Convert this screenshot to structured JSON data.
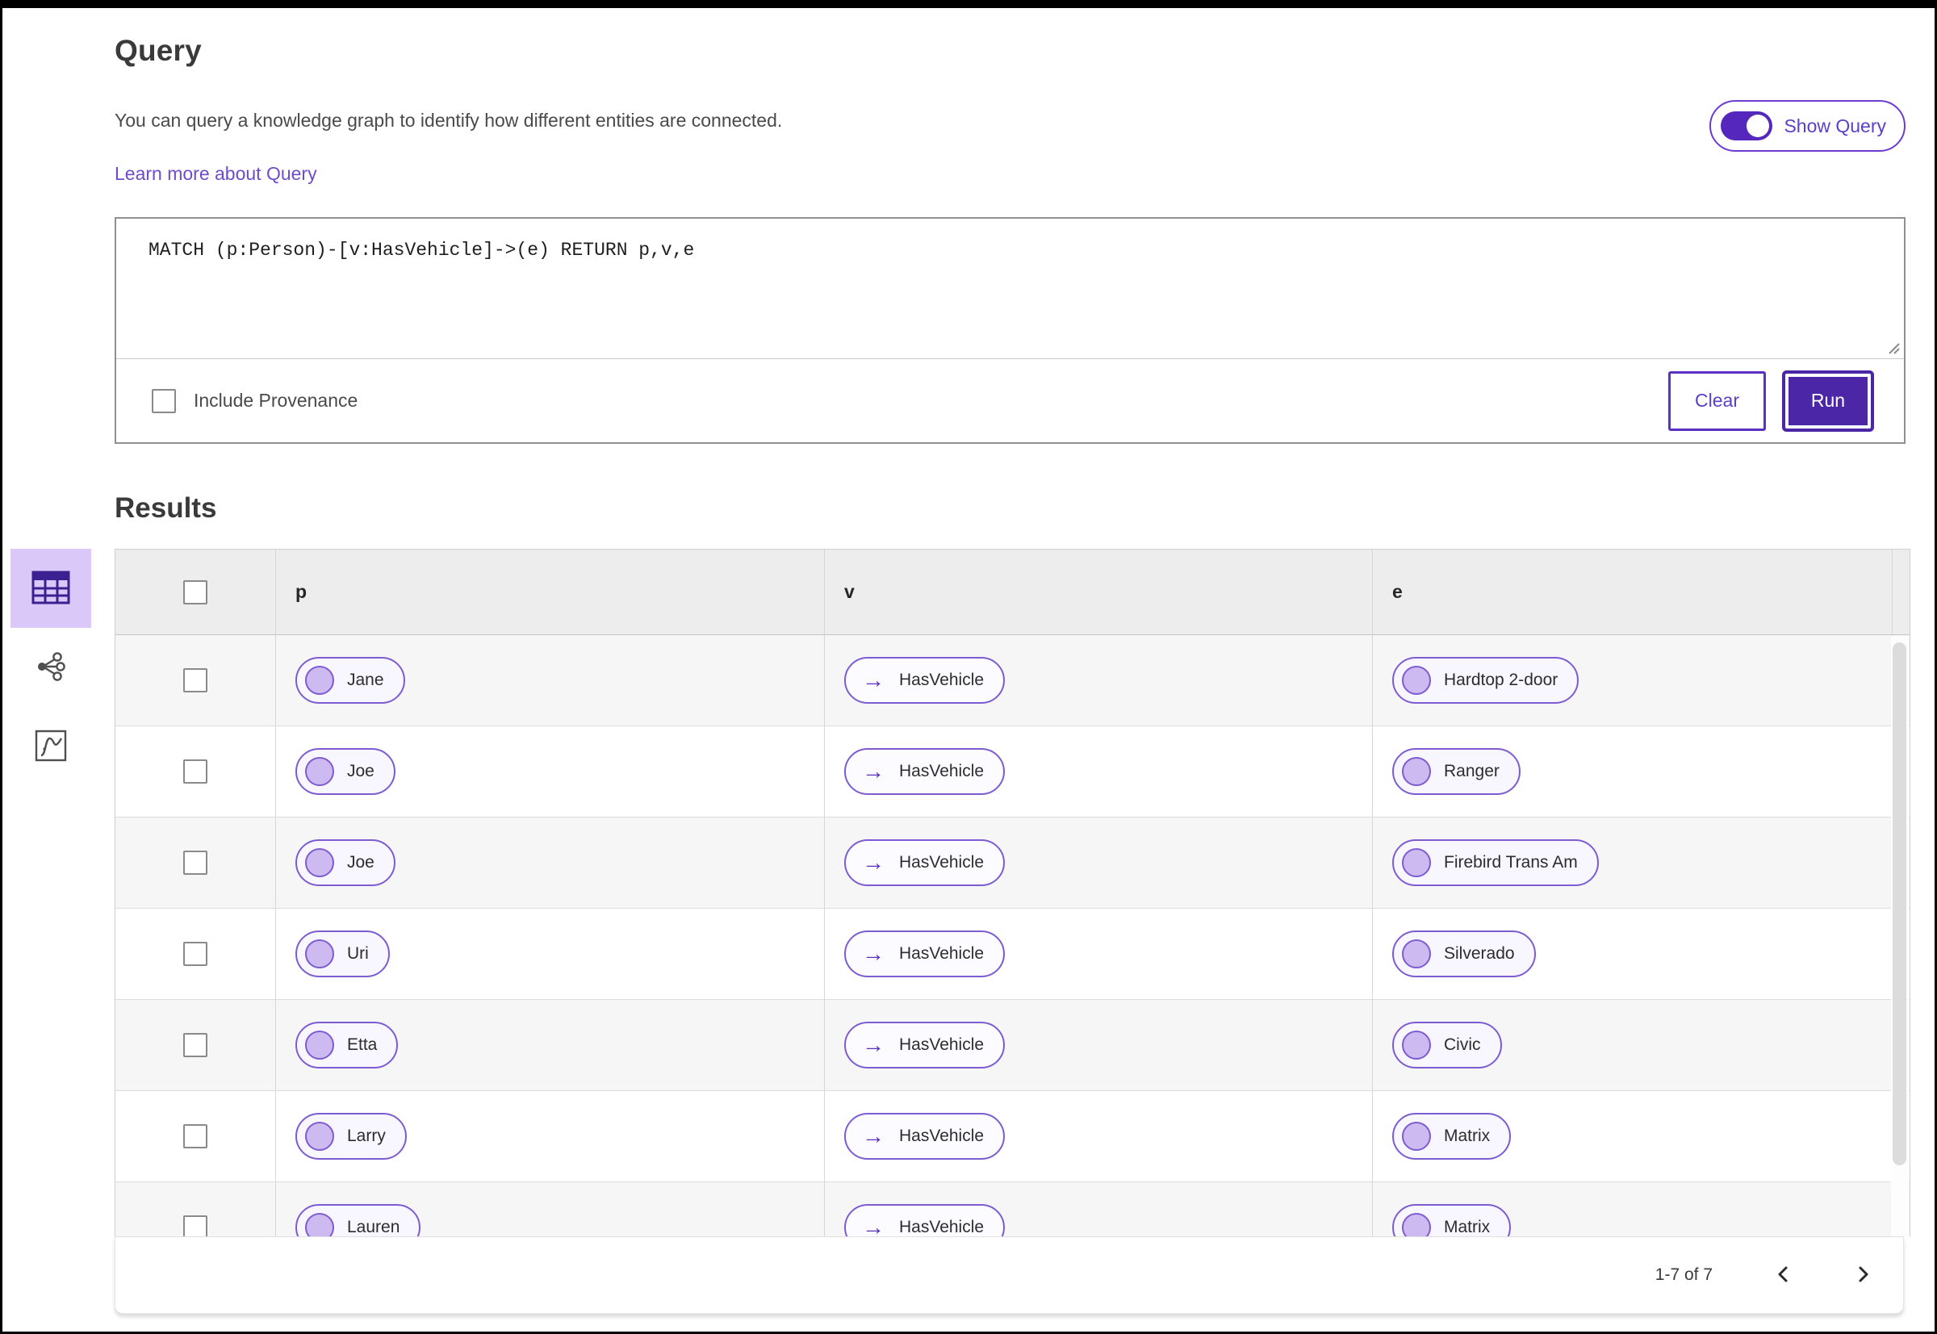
{
  "query_section": {
    "title": "Query",
    "description": "You can query a knowledge graph to identify how different entities are connected.",
    "learn_more_label": "Learn more about Query",
    "show_query_label": "Show Query",
    "show_query_state": "on",
    "query_text": "MATCH (p:Person)-[v:HasVehicle]->(e) RETURN p,v,e",
    "include_provenance_label": "Include Provenance",
    "include_provenance_checked": false,
    "clear_label": "Clear",
    "run_label": "Run"
  },
  "results_section": {
    "title": "Results",
    "view_rail": [
      {
        "icon": "table-view-icon",
        "selected": true
      },
      {
        "icon": "graph-view-icon",
        "selected": false
      },
      {
        "icon": "chart-view-icon",
        "selected": false
      }
    ],
    "table": {
      "columns": [
        "p",
        "v",
        "e"
      ],
      "rows": [
        {
          "p": "Jane",
          "v": "HasVehicle",
          "e": "Hardtop 2-door"
        },
        {
          "p": "Joe",
          "v": "HasVehicle",
          "e": "Ranger"
        },
        {
          "p": "Joe",
          "v": "HasVehicle",
          "e": "Firebird Trans Am"
        },
        {
          "p": "Uri",
          "v": "HasVehicle",
          "e": "Silverado"
        },
        {
          "p": "Etta",
          "v": "HasVehicle",
          "e": "Civic"
        },
        {
          "p": "Larry",
          "v": "HasVehicle",
          "e": "Matrix"
        },
        {
          "p": "Lauren",
          "v": "HasVehicle",
          "e": "Matrix"
        }
      ]
    },
    "pagination": {
      "range_label": "1-7 of 7"
    }
  },
  "icons": {
    "edge_arrow": "→",
    "prev_icon": "chevron-left",
    "next_icon": "chevron-right"
  },
  "colors": {
    "accent": "#5b2dc1",
    "run_button_bg": "#4b26a7",
    "chip_border": "#7d5cd2",
    "chip_circle_fill": "#ccbaf1",
    "selected_tab_bg": "#d9c8f8",
    "table_header_bg": "#ededed",
    "row_alt_bg": "#f6f6f6",
    "link_color": "#6d4dc9"
  }
}
